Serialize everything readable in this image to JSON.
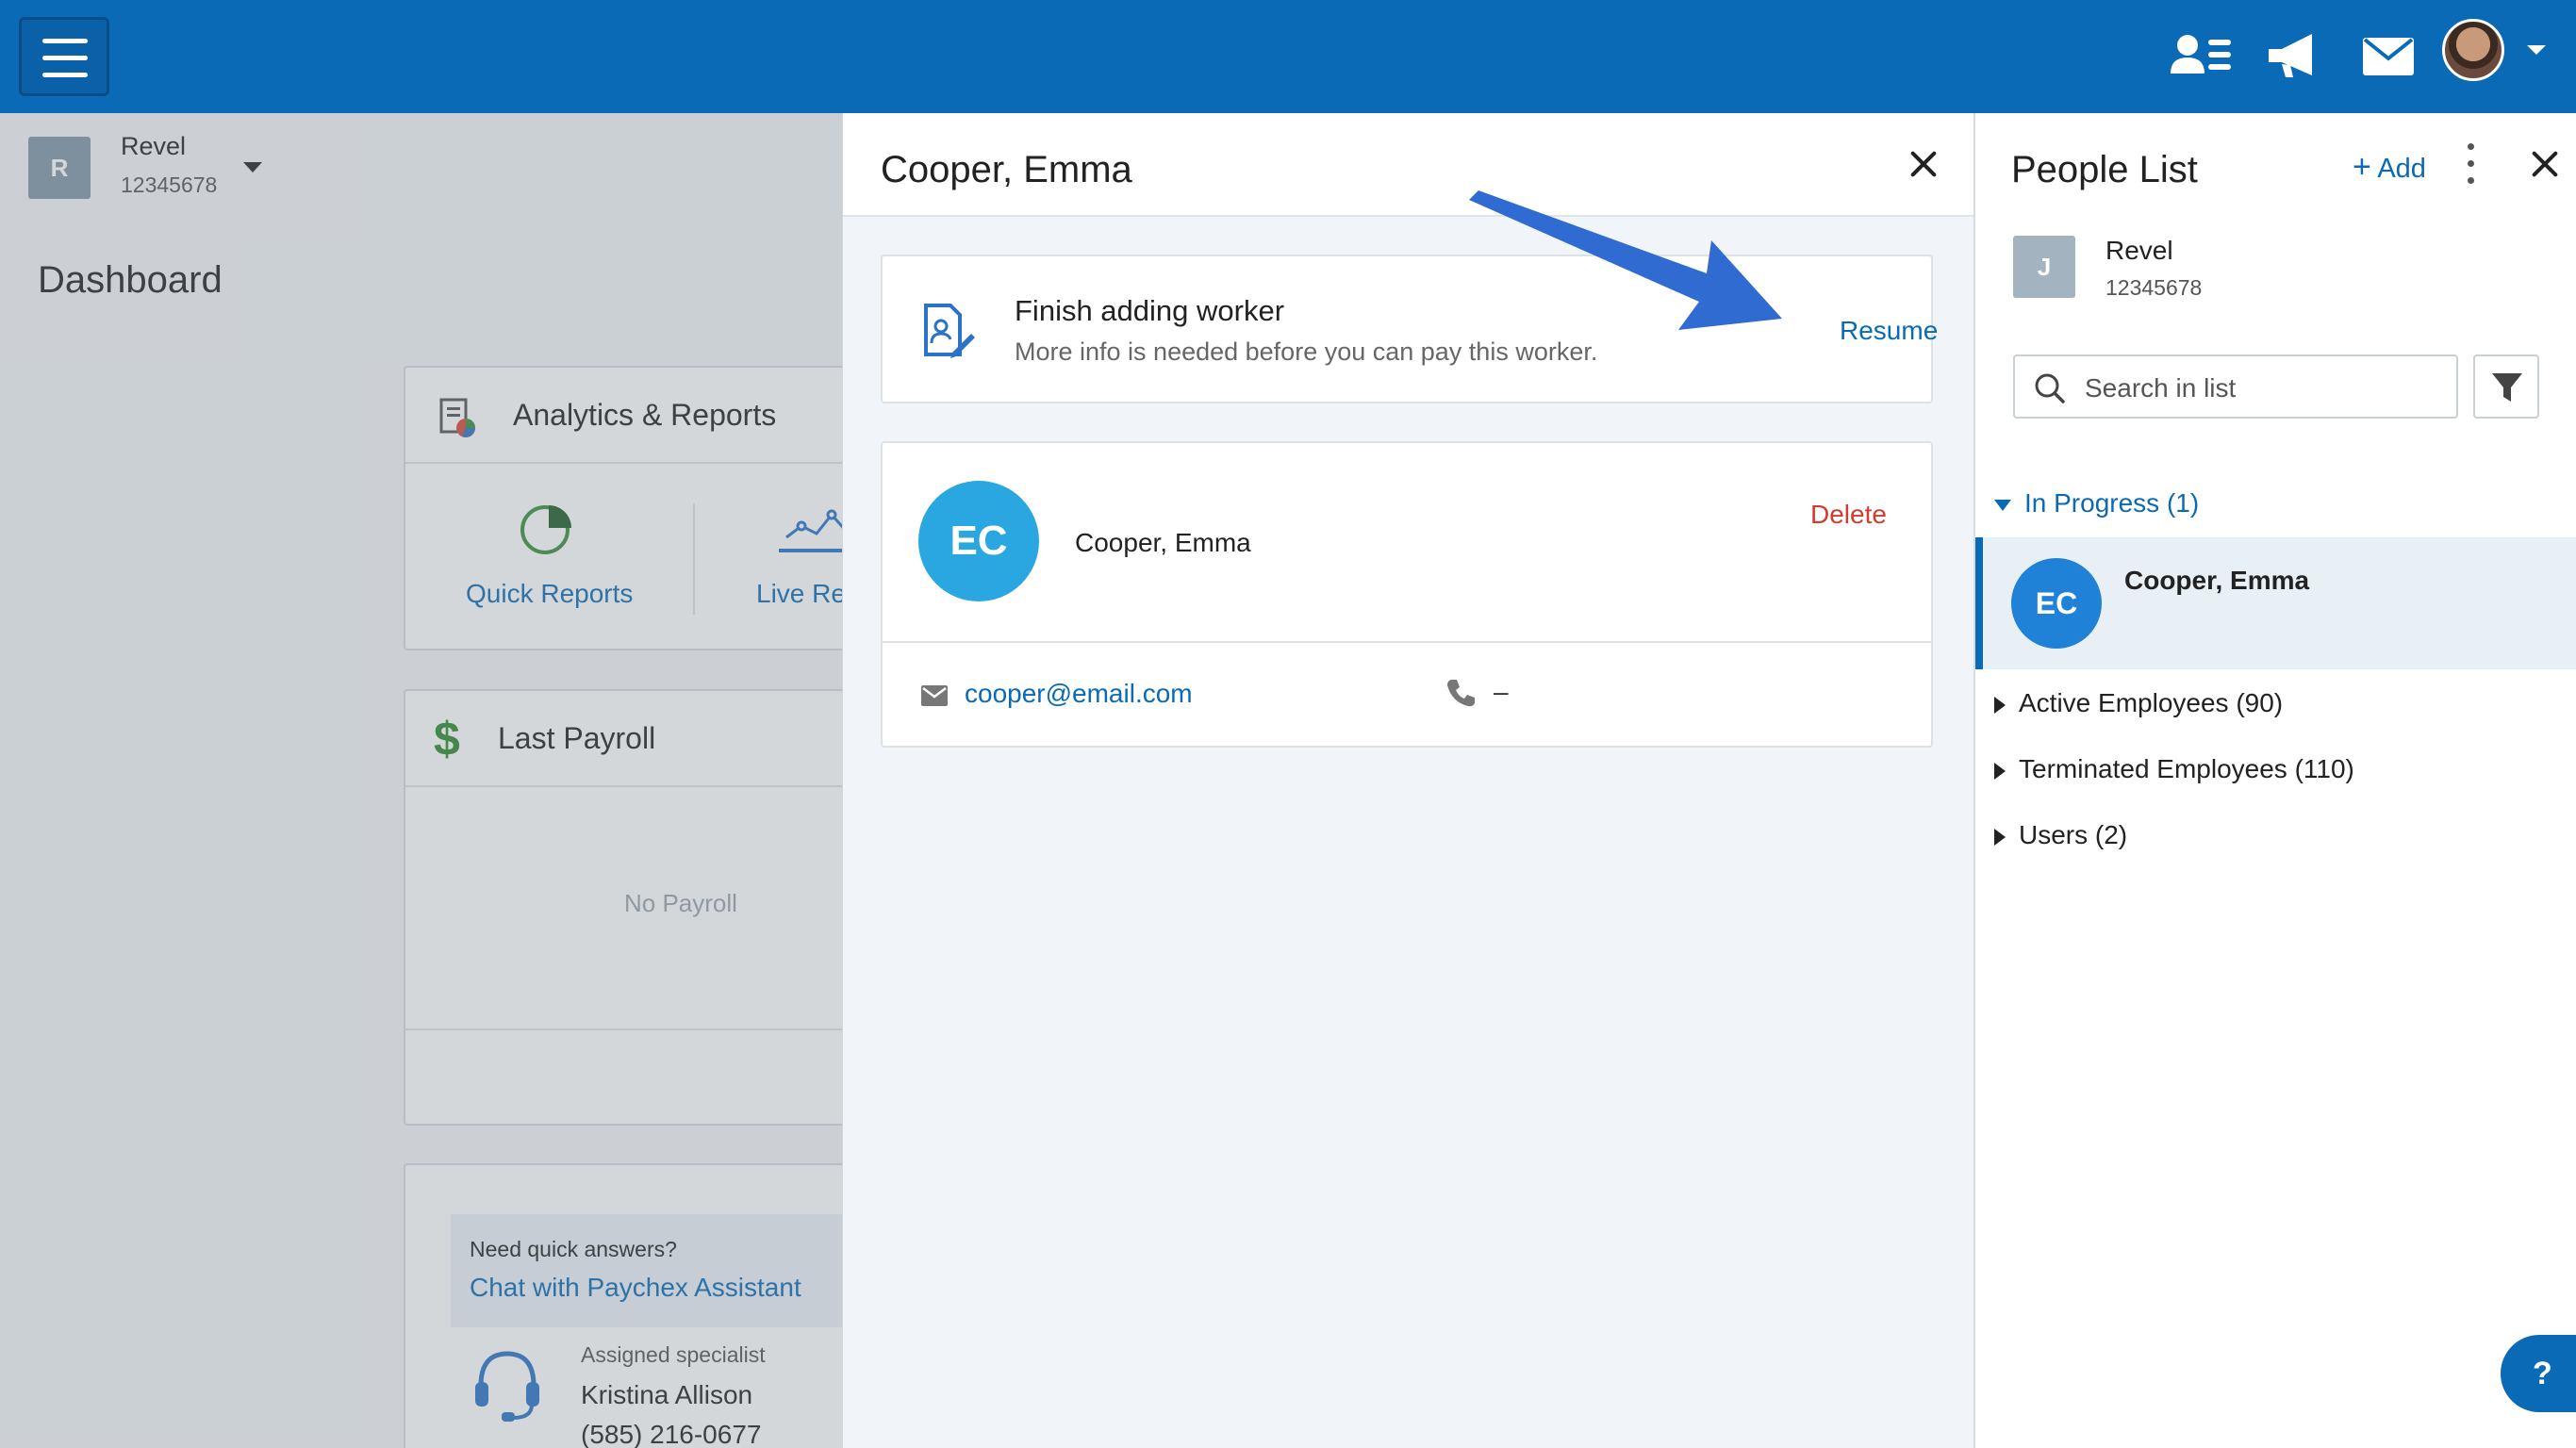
{
  "topbar": {
    "icons": [
      "menu-icon",
      "people-list-icon",
      "megaphone-icon",
      "mail-icon",
      "user-avatar",
      "chevron-down-icon"
    ]
  },
  "dashboard": {
    "company": {
      "initial": "R",
      "name": "Revel",
      "id": "12345678"
    },
    "title": "Dashboard",
    "analytics": {
      "title": "Analytics & Reports",
      "links": [
        "Quick Reports",
        "Live Re"
      ]
    },
    "payroll": {
      "title": "Last Payroll",
      "empty_text": "No Payroll"
    },
    "help": {
      "question": "Need quick answers?",
      "chat_link": "Chat with Paychex Assistant",
      "specialist_label": "Assigned specialist",
      "specialist_name": "Kristina Allison",
      "specialist_phone": "(585) 216-0677"
    }
  },
  "worker_panel": {
    "title": "Cooper, Emma",
    "finish": {
      "title": "Finish adding worker",
      "subtitle": "More info is needed before you can pay this worker.",
      "action": "Resume"
    },
    "worker": {
      "initials": "EC",
      "name": "Cooper, Emma",
      "delete_label": "Delete",
      "email": "cooper@email.com",
      "phone": "–"
    }
  },
  "people_panel": {
    "title": "People List",
    "add_label": "Add",
    "company": {
      "initial": "J",
      "name": "Revel",
      "id": "12345678"
    },
    "search": {
      "placeholder": "Search in list"
    },
    "groups": {
      "in_progress": "In Progress  (1)",
      "active": "Active Employees  (90)",
      "terminated": "Terminated Employees  (110)",
      "users": "Users  (2)"
    },
    "selected": {
      "initials": "EC",
      "name": "Cooper, Emma"
    }
  },
  "help_button": {
    "label": "?"
  },
  "colors": {
    "brand_blue": "#0a6ab5",
    "avatar_teal": "#2aa7e0",
    "delete_red": "#d23b2f",
    "arrow_blue": "#2f6bd1"
  }
}
